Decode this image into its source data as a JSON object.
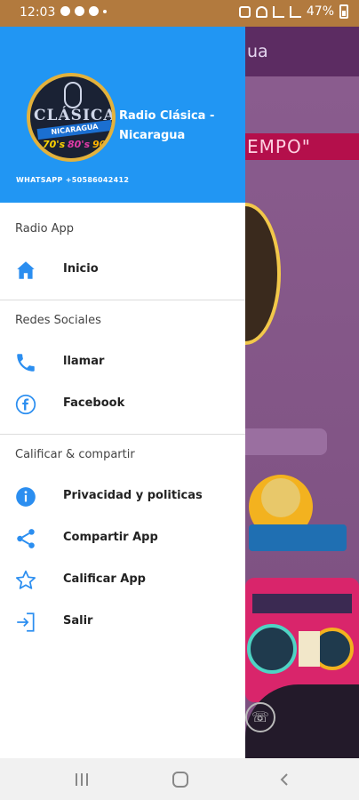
{
  "status_bar": {
    "time": "12:03",
    "battery": "47%"
  },
  "background_app": {
    "title_fragment": "ua",
    "banner_fragment": "EMPO\""
  },
  "drawer": {
    "header": {
      "logo": {
        "word": "CLÁSICA",
        "ribbon": "NICARAGUA",
        "y70": "70's",
        "y80": "80's",
        "y90": "90's"
      },
      "app_name": "Radio Clásica - Nicaragua",
      "whatsapp": "WHATSAPP +50586042412"
    },
    "sections": [
      {
        "title": "Radio App",
        "items": [
          {
            "label": "Inicio",
            "icon": "home-icon"
          }
        ]
      },
      {
        "title": "Redes Sociales",
        "items": [
          {
            "label": "llamar",
            "icon": "phone-icon"
          },
          {
            "label": "Facebook",
            "icon": "facebook-icon"
          }
        ]
      },
      {
        "title": "Calificar & compartir",
        "items": [
          {
            "label": "Privacidad y politicas",
            "icon": "info-icon"
          },
          {
            "label": "Compartir App",
            "icon": "share-icon"
          },
          {
            "label": "Calificar App",
            "icon": "star-icon"
          },
          {
            "label": "Salir",
            "icon": "exit-icon"
          }
        ]
      }
    ]
  },
  "colors": {
    "status_bar": "#b27a3e",
    "drawer_header": "#2196f3",
    "icon_blue": "#2b8ef0"
  }
}
